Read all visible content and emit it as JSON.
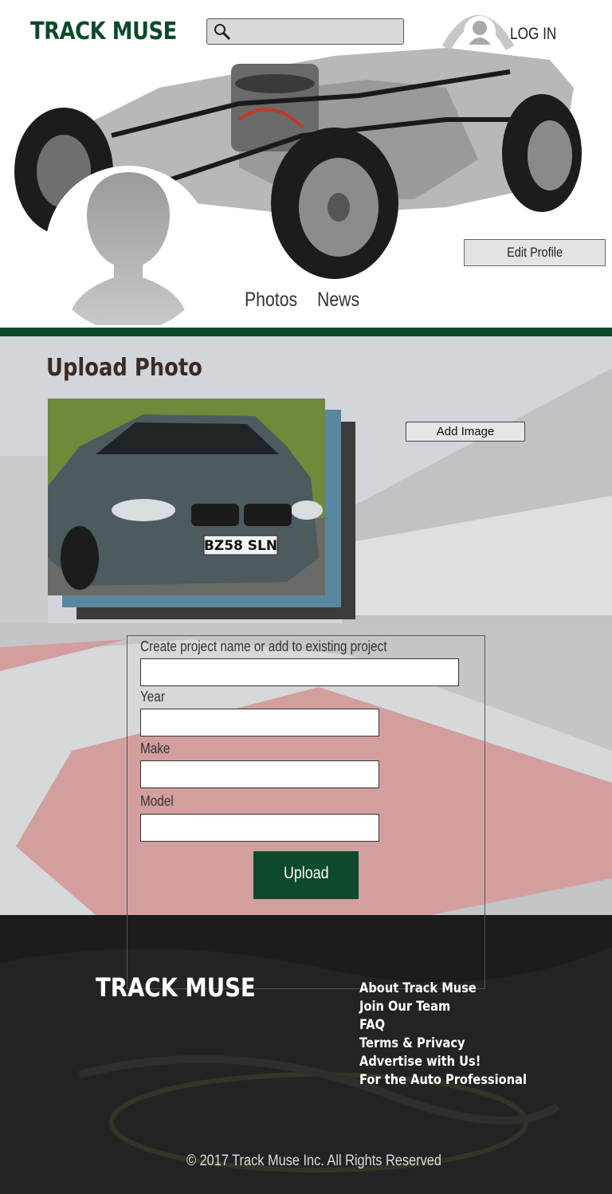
{
  "header": {
    "logo": "TRACK MUSE",
    "search": {
      "placeholder": ""
    },
    "login_label": "LOG IN"
  },
  "profile": {
    "edit_label": "Edit Profile",
    "tabs": [
      {
        "label": "Photos"
      },
      {
        "label": "News"
      }
    ]
  },
  "upload": {
    "title": "Upload Photo",
    "add_image_label": "Add Image",
    "plate_text": "BZ58 SLN",
    "fields": [
      {
        "label": "Create project name or add to existing project",
        "value": ""
      },
      {
        "label": "Year",
        "value": ""
      },
      {
        "label": "Make",
        "value": ""
      },
      {
        "label": "Model",
        "value": ""
      }
    ],
    "submit_label": "Upload"
  },
  "footer": {
    "logo": "TRACK MUSE",
    "links": [
      "About Track Muse",
      "Join Our Team",
      "FAQ",
      "Terms & Privacy",
      "Advertise with Us!",
      "For the Auto Professional"
    ],
    "copyright": "© 2017 Track Muse Inc. All Rights Reserved"
  },
  "colors": {
    "brand_green": "#0c4a2b",
    "footer_bg": "#222222",
    "title_brown": "#3a2a26"
  }
}
